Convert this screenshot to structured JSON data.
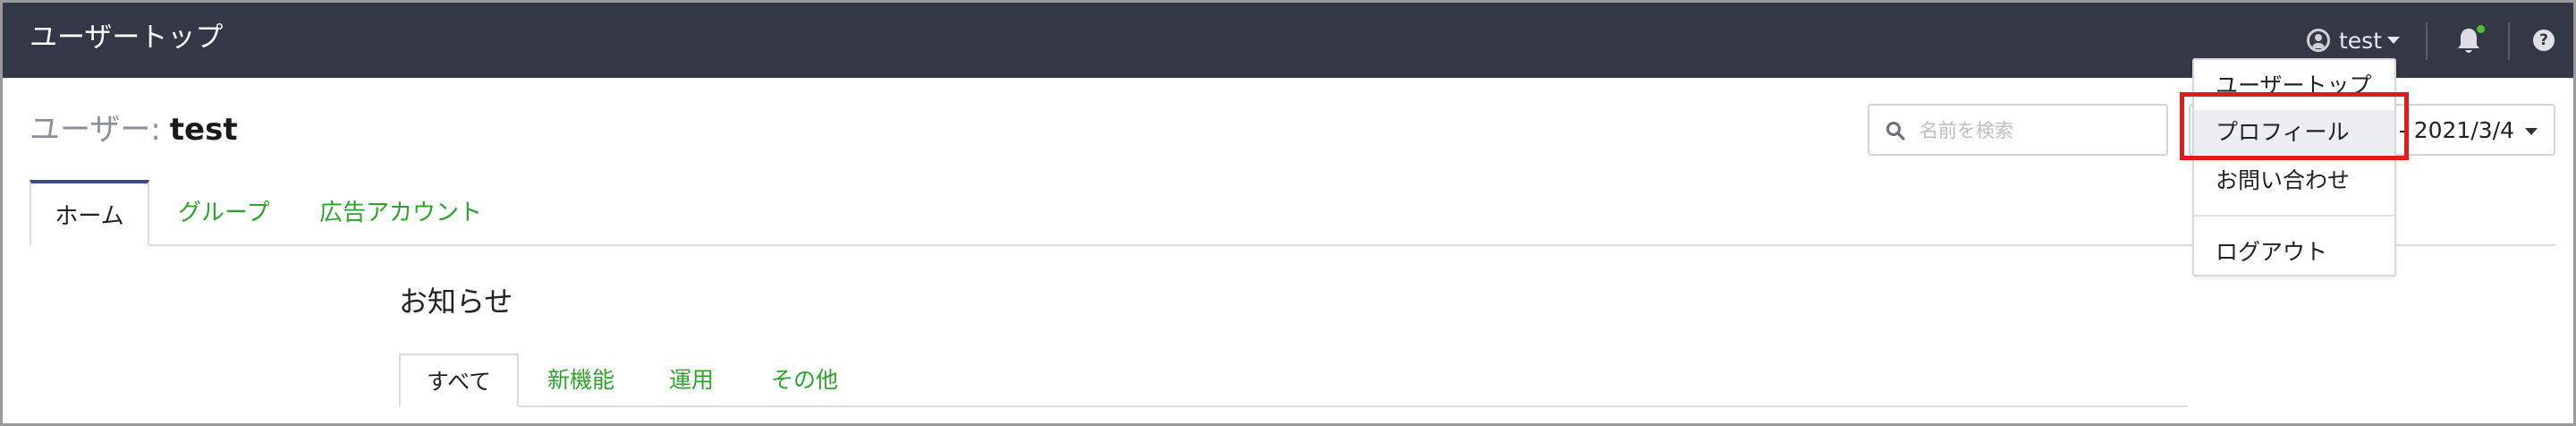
{
  "header": {
    "app_title": "ユーザートップ",
    "user_name": "test",
    "icons": [
      "user-circle-icon",
      "bell-icon",
      "help-icon"
    ],
    "colors": {
      "background": "#343846",
      "notification_dot": "#4cc23a"
    }
  },
  "page": {
    "heading_label": "ユーザー:",
    "heading_name": "test"
  },
  "search": {
    "placeholder": "名前を検索"
  },
  "date_range": {
    "value": "4 - 2021/3/4"
  },
  "main_tabs": [
    {
      "label": "ホーム",
      "active": true
    },
    {
      "label": "グループ",
      "active": false
    },
    {
      "label": "広告アカウント",
      "active": false
    }
  ],
  "notice": {
    "title": "お知らせ",
    "tabs": [
      {
        "label": "すべて",
        "active": true
      },
      {
        "label": "新機能",
        "active": false
      },
      {
        "label": "運用",
        "active": false
      },
      {
        "label": "その他",
        "active": false
      }
    ]
  },
  "user_dropdown": {
    "items": [
      "ユーザートップ",
      "プロフィール",
      "お問い合わせ",
      "ログアウト"
    ],
    "highlighted_item": "プロフィール",
    "highlight_color": "#e01b1b"
  },
  "accent_color": "#2aa52a",
  "active_tab_border": "#3c4a8c"
}
